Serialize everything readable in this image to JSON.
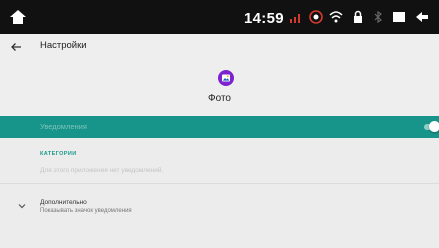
{
  "status_bar": {
    "time": "14:59",
    "icons": [
      "home-icon",
      "signal-icon",
      "location-icon",
      "wifi-icon",
      "lock-icon",
      "bluetooth-icon",
      "window-icon",
      "back-icon"
    ]
  },
  "app_bar": {
    "title": "Настройки",
    "back_icon": "arrow-back-icon"
  },
  "app_info": {
    "name": "Фото",
    "icon": "photo-app-icon",
    "icon_color": "#7b22d1"
  },
  "master_toggle": {
    "label": "Уведомления",
    "state": "on",
    "accent": "#17958a"
  },
  "categories": {
    "header": "КАТЕГОРИИ",
    "empty_text": "Для этого приложения нет уведомлений."
  },
  "advanced": {
    "title": "Дополнительно",
    "subtitle": "Показывать значок уведомления"
  }
}
